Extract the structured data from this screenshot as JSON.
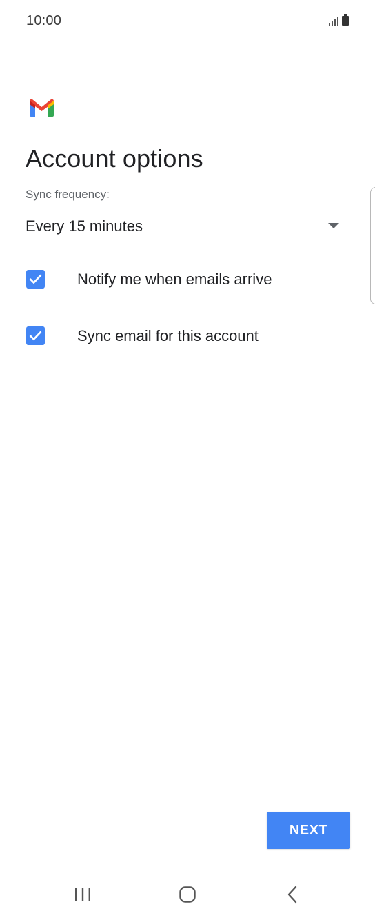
{
  "status_bar": {
    "time": "10:00",
    "icons": [
      "signal-icon",
      "battery-icon"
    ]
  },
  "app": {
    "logo": "gmail-logo-icon",
    "brand_colors": {
      "red": "#ea4335",
      "blue": "#4285f4",
      "green": "#34a853",
      "yellow": "#fbbc04"
    }
  },
  "main": {
    "title": "Account options",
    "sync": {
      "label": "Sync frequency:",
      "selected_value": "Every 15 minutes"
    },
    "options": [
      {
        "label": "Notify me when emails arrive",
        "checked": true
      },
      {
        "label": "Sync email for this account",
        "checked": true
      }
    ]
  },
  "footer": {
    "next_label": "NEXT",
    "accent_color": "#4285f4"
  },
  "nav_bar": {
    "buttons": [
      "recents-icon",
      "home-icon",
      "back-icon"
    ]
  }
}
